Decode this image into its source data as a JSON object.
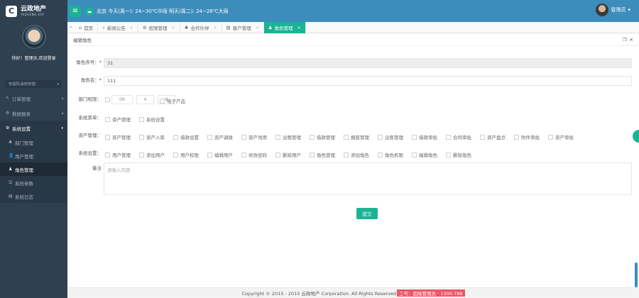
{
  "brand": {
    "name": "云政地产",
    "sub": "YAZHENG EST"
  },
  "topbar": {
    "menu_icon": "≡",
    "weather_icon": "weather-icon",
    "weather_text": "北京  今天(周一): 24~30℃中雨 明天(周二): 24~28℃大雨",
    "user_name": "管理员",
    "user_caret": "▾"
  },
  "sidebar": {
    "greeting": "你好！管理员,欢迎登录",
    "role_select": "管理员(系统管理)",
    "items": [
      {
        "label": "订单管理",
        "icon": "✎",
        "caret": "◂"
      },
      {
        "label": "数据报表",
        "icon": "⚙",
        "caret": "◂"
      },
      {
        "label": "系统设置",
        "icon": "⚙",
        "caret": "▾"
      }
    ],
    "sub_items": [
      {
        "label": "部门管理",
        "icon": "♣"
      },
      {
        "label": "用户管理",
        "icon": "👤"
      },
      {
        "label": "角色管理",
        "icon": "♟"
      },
      {
        "label": "系统参数",
        "icon": "☰"
      },
      {
        "label": "系统日志",
        "icon": "▤"
      }
    ]
  },
  "tabs": [
    {
      "label": "首页",
      "icon": "⌂"
    },
    {
      "label": "新闻公告",
      "icon": "⌕"
    },
    {
      "label": "权限管理",
      "icon": "⚙"
    },
    {
      "label": "合作伙伴",
      "icon": "♣"
    },
    {
      "label": "客户管理",
      "icon": "▤"
    },
    {
      "label": "角色管理",
      "icon": "♟"
    }
  ],
  "panel": {
    "title": "编辑角色"
  },
  "form": {
    "id_label": "角色序号：*",
    "id_value": "31",
    "name_label": "角色名：*",
    "name_value": "111",
    "dept_label": "部门权限：",
    "dept_values": [
      "06",
      "4",
      "8"
    ],
    "dept_extra": "电子产品",
    "system_label": "系统菜单：",
    "system_opts": [
      "资产管理",
      "系统设置"
    ],
    "asset_label": "资产管理：",
    "asset_opts": [
      "资产管理",
      "资产入库",
      "借款设置",
      "资产调拨",
      "资产领用",
      "出租管理",
      "借款管理",
      "报废管理",
      "出售管理",
      "借款审批",
      "合同审批",
      "资产盘点",
      "附件审批",
      "资产审批"
    ],
    "settings_label": "系统设置：",
    "settings_opts": [
      "用户管理",
      "添加用户",
      "用户权限",
      "编辑用户",
      "修改密码",
      "删除用户",
      "角色管理",
      "添加角色",
      "角色权限",
      "编辑角色",
      "删除角色"
    ],
    "remark_label": "备注",
    "remark_placeholder": "请输入内容",
    "submit_label": "提交"
  },
  "footer": {
    "text": "Copyright © 2015 - 2015 云政地产 Corporation. All Rights Reserved",
    "badge": "工号：超级管理员 · 1300-789"
  }
}
